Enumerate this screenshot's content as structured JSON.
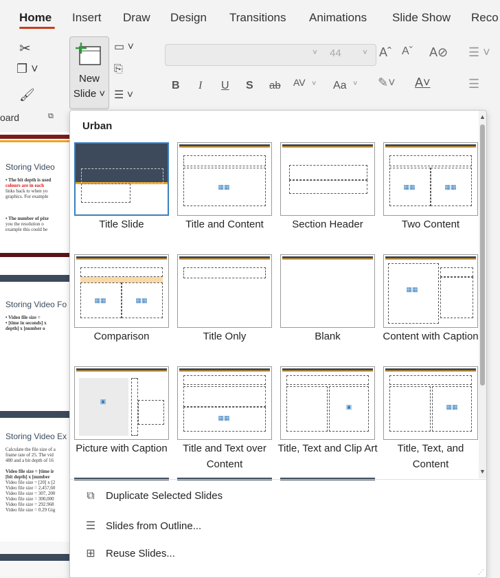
{
  "ribbon": {
    "tabs": [
      "Home",
      "Insert",
      "Draw",
      "Design",
      "Transitions",
      "Animations",
      "Slide Show",
      "Reco"
    ],
    "new_slide_label_1": "New",
    "new_slide_label_2": "Slide ˅",
    "font_size": "44",
    "clipboard_label": "oard",
    "increase_font": "Aˆ",
    "decrease_font": "Aˇ",
    "bold": "B",
    "italic": "I",
    "underline": "U",
    "shadow": "S",
    "strike": "ab",
    "spacing": "AV",
    "case": "Aa"
  },
  "thumbnails": [
    {
      "title": "Storing Video",
      "lines": [
        "• The bit depth is used",
        "colours are in each",
        "links back to when yo",
        "graphics. For example",
        "",
        "• The number of pixe",
        "you the resolution o",
        "example this could be"
      ]
    },
    {
      "title": "Storing Video Fo",
      "lines": [
        "• Video file size =",
        "• [time in seconds] x",
        "depth] x [number o"
      ]
    },
    {
      "title": "Storing Video Ex",
      "lines": [
        "Calculate the file size of a",
        "frame rate of 25. The vid",
        "480 and a bit depth of 16",
        "",
        "Video file size = [time ir",
        "[bit depth] x [number",
        "Video file size = [20] x [2",
        "Video file size = 2,457,60",
        "Video file size = 307, 200",
        "Video file size = 300,000",
        "Video file size = 292.968",
        "Video file size = 0.29 Gig"
      ]
    }
  ],
  "panel": {
    "title": "Urban",
    "layouts": [
      {
        "label": "Title Slide"
      },
      {
        "label": "Title and Content"
      },
      {
        "label": "Section Header"
      },
      {
        "label": "Two Content"
      },
      {
        "label": "Comparison"
      },
      {
        "label": "Title Only"
      },
      {
        "label": "Blank"
      },
      {
        "label": "Content with Caption"
      },
      {
        "label": "Picture with Caption"
      },
      {
        "label": "Title and Text over Content"
      },
      {
        "label": "Title, Text and Clip Art"
      },
      {
        "label": "Title, Text, and Content"
      }
    ],
    "commands": [
      {
        "label": "Duplicate Selected Slides",
        "icon": "duplicate-icon"
      },
      {
        "label": "Slides from Outline...",
        "icon": "outline-icon"
      },
      {
        "label": "Reuse Slides...",
        "icon": "reuse-icon"
      }
    ]
  },
  "colors": {
    "accent": "#c43e1c",
    "theme_dark": "#3c4a5c",
    "theme_gold": "#f0a31a"
  }
}
